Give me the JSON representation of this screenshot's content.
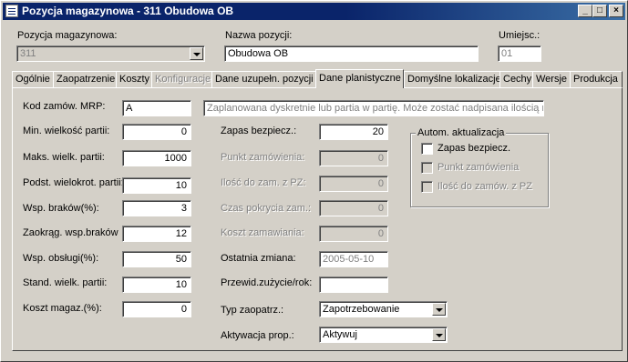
{
  "window": {
    "title": "Pozycja magazynowa - 311 Obudowa OB",
    "minimize": "_",
    "maximize": "□",
    "close": "×"
  },
  "header": {
    "pozycja_label": "Pozycja magazynowa:",
    "pozycja_value": "311",
    "nazwa_label": "Nazwa pozycji:",
    "nazwa_value": "Obudowa OB",
    "miejsce_label": "Umiejsc.:",
    "miejsce_value": "01"
  },
  "tabs": [
    {
      "label": "Ogólnie"
    },
    {
      "label": "Zaopatrzenie"
    },
    {
      "label": "Koszty"
    },
    {
      "label": "Konfiguracje"
    },
    {
      "label": "Dane uzupełn. pozycji"
    },
    {
      "label": "Dane planistyczne"
    },
    {
      "label": "Domyślne lokalizacje"
    },
    {
      "label": "Cechy"
    },
    {
      "label": "Wersje"
    },
    {
      "label": "Produkcja"
    }
  ],
  "form": {
    "kod_mrp_label": "Kod zamów. MRP:",
    "kod_mrp_value": "A",
    "kod_mrp_desc": "Zaplanowana dyskretnie lub partia w partię. Może zostać nadpisana ilością mi",
    "min_label": "Min. wielkość partii:",
    "min_value": "0",
    "maks_label": "Maks. wielk. partii:",
    "maks_value": "1000",
    "podst_label": "Podst. wielokrot. partii:",
    "podst_value": "10",
    "wsp_brakow_label": "Wsp. braków(%):",
    "wsp_brakow_value": "3",
    "zaokrag_label": "Zaokrąg. wsp.braków",
    "zaokrag_value": "12",
    "wsp_obslugi_label": "Wsp. obsługi(%):",
    "wsp_obslugi_value": "50",
    "stand_label": "Stand. wielk. partii:",
    "stand_value": "10",
    "koszt_mag_label": "Koszt magaz.(%):",
    "koszt_mag_value": "0",
    "zapas_label": "Zapas bezpiecz.:",
    "zapas_value": "20",
    "punkt_label": "Punkt zamówienia:",
    "punkt_value": "0",
    "ilosc_label": "Ilość do zam. z PZ:",
    "ilosc_value": "0",
    "czas_label": "Czas pokrycia zam.:",
    "czas_value": "0",
    "koszt_zam_label": "Koszt zamawiania:",
    "koszt_zam_value": "0",
    "ostatnia_label": "Ostatnia zmiana:",
    "ostatnia_value": "2005-05-10",
    "przewid_label": "Przewid.zużycie/rok:",
    "przewid_value": "",
    "typ_label": "Typ zaopatrz.:",
    "typ_value": "Zapotrzebowanie",
    "aktyw_label": "Aktywacja prop.:",
    "aktyw_value": "Aktywuj"
  },
  "autom": {
    "title": "Autom. aktualizacja",
    "zapas": "Zapas bezpiecz.",
    "punkt": "Punkt zamówienia",
    "ilosc": "Ilość do zamów. z PZ"
  }
}
